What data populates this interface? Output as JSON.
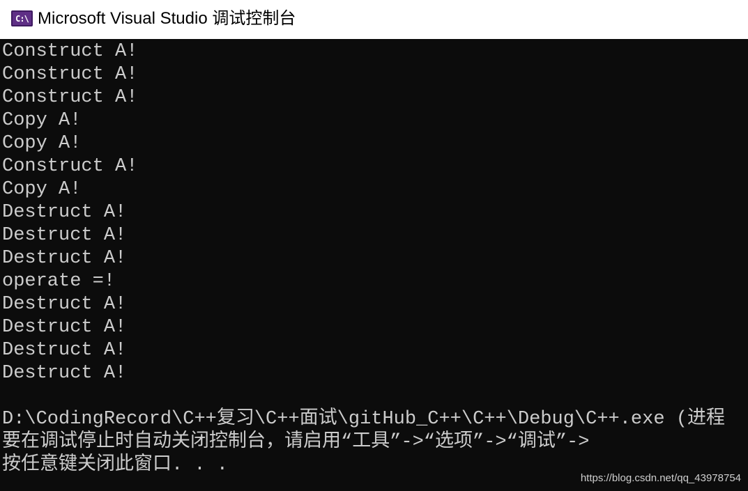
{
  "window": {
    "title": "Microsoft Visual Studio 调试控制台",
    "icon": "vs-debug-console-icon",
    "icon_glyph": "C:\\",
    "title_bg": "#ffffff",
    "console_bg": "#0c0c0c",
    "console_fg": "#cccccc"
  },
  "console": {
    "lines": [
      "Construct A!",
      "Construct A!",
      "Construct A!",
      "Copy A!",
      "Copy A!",
      "Construct A!",
      "Copy A!",
      "Destruct A!",
      "Destruct A!",
      "Destruct A!",
      "operate =!",
      "Destruct A!",
      "Destruct A!",
      "Destruct A!",
      "Destruct A!",
      "",
      "D:\\CodingRecord\\C++复习\\C++面试\\gitHub_C++\\C++\\Debug\\C++.exe (进程",
      "要在调试停止时自动关闭控制台，请启用“工具”->“选项”->“调试”->",
      "按任意键关闭此窗口. . ."
    ]
  },
  "watermark": {
    "text": "https://blog.csdn.net/qq_43978754"
  }
}
